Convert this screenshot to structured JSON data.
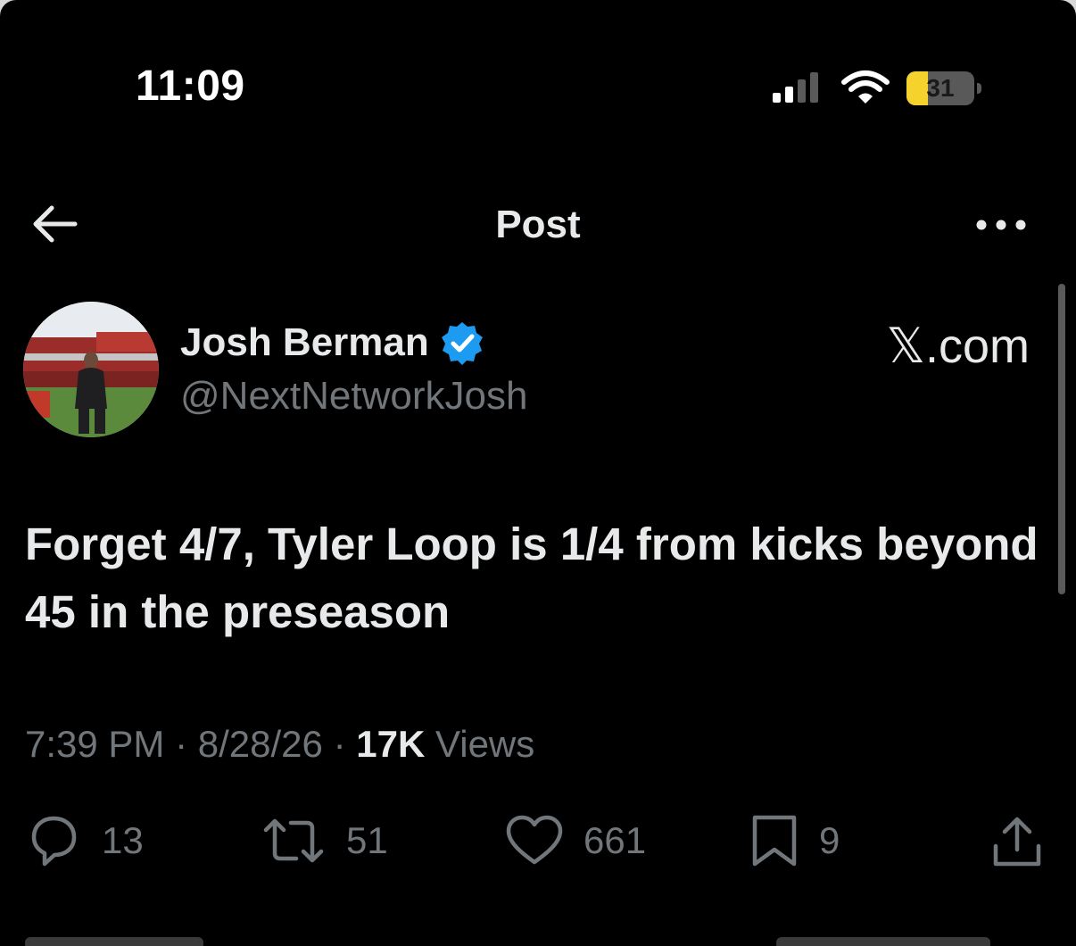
{
  "status_bar": {
    "time": "11:09",
    "battery_level": "31",
    "battery_fraction": 0.31,
    "signal_bars_active": 2,
    "signal_bars_total": 4
  },
  "header": {
    "title": "Post",
    "back_icon": "arrow-left-icon",
    "more_icon": "ellipsis-icon"
  },
  "author": {
    "name": "Josh Berman",
    "handle": "@NextNetworkJosh",
    "verified": true,
    "verified_color": "#1d9bf0",
    "source": "𝕏.com"
  },
  "post": {
    "text": "Forget 4/7, Tyler Loop is 1/4 from kicks beyond 45 in the preseason",
    "time": "7:39 PM",
    "date": "8/28/26",
    "separator": "·",
    "views_count": "17K",
    "views_label": "Views"
  },
  "actions": {
    "replies": "13",
    "reposts": "51",
    "likes": "661",
    "bookmarks": "9",
    "icons": [
      "reply-icon",
      "repost-icon",
      "like-icon",
      "bookmark-icon",
      "share-icon"
    ]
  },
  "colors": {
    "background": "#000000",
    "text_primary": "#e7e9ea",
    "text_secondary": "#71767b",
    "battery_yellow": "#f5d22c"
  }
}
